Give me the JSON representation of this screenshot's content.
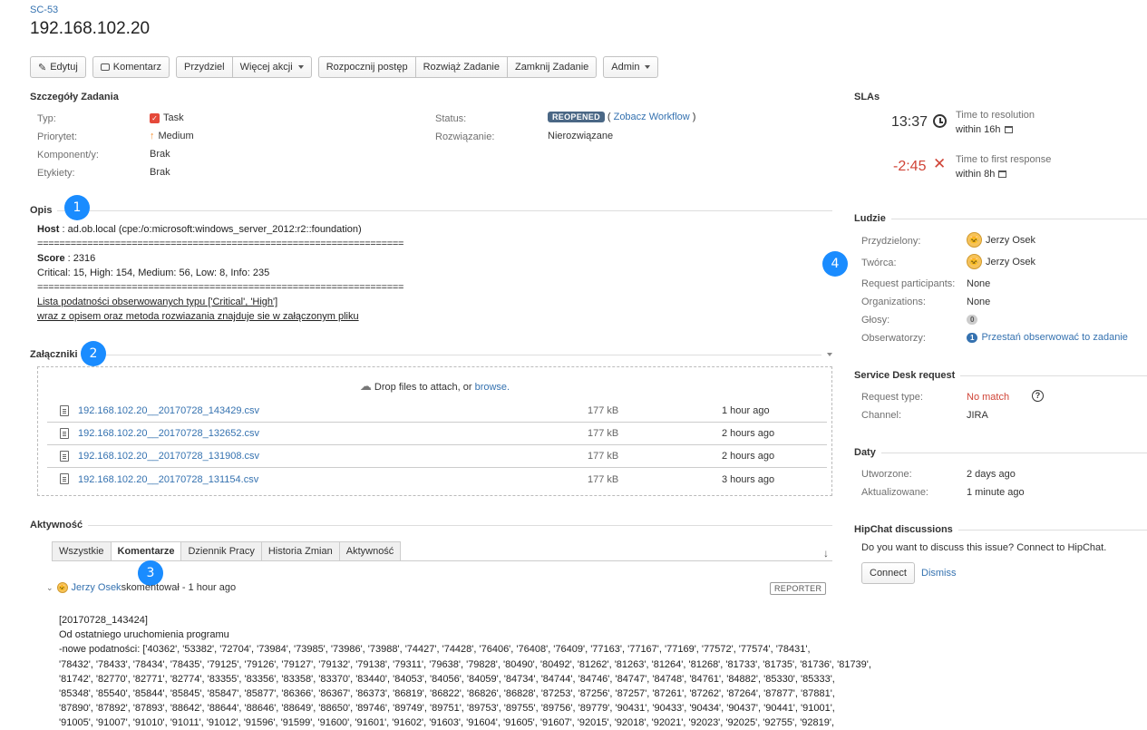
{
  "issue": {
    "key": "SC-53",
    "title": "192.168.102.20"
  },
  "toolbar": {
    "edit": "Edytuj",
    "comment": "Komentarz",
    "assign": "Przydziel",
    "more": "Więcej akcji",
    "start": "Rozpocznij postęp",
    "resolve": "Rozwiąż Zadanie",
    "close": "Zamknij Zadanie",
    "admin": "Admin"
  },
  "details": {
    "heading": "Szczegóły Zadania",
    "type_label": "Typ:",
    "type_value": "Task",
    "priority_label": "Priorytet:",
    "priority_value": "Medium",
    "components_label": "Komponent/y:",
    "components_value": "Brak",
    "labels_label": "Etykiety:",
    "labels_value": "Brak",
    "status_label": "Status:",
    "status_value": "REOPENED",
    "workflow_link": "Zobacz Workflow",
    "resolution_label": "Rozwiązanie:",
    "resolution_value": "Nierozwiązane"
  },
  "description": {
    "heading": "Opis",
    "host_label": "Host",
    "host_value": " : ad.ob.local (cpe:/o:microsoft:windows_server_2012:r2::foundation)",
    "separator": "==================================================================",
    "score_label": "Score",
    "score_value": " : 2316",
    "counts": "Critical: 15, High: 154, Medium: 56, Low: 8, Info: 235",
    "list_link": "Lista podatności",
    "list_rest": " obserwowanych typu ['Critical', 'High']",
    "attach_line": "wraz z opisem oraz metoda rozwiazania znajduje sie w załączonym pliku"
  },
  "attachments": {
    "heading": "Załączniki",
    "drop_text": "Drop files to attach, or ",
    "browse": "browse.",
    "files": [
      {
        "name": "192.168.102.20__20170728_143429.csv",
        "size": "177 kB",
        "date": "1 hour ago"
      },
      {
        "name": "192.168.102.20__20170728_132652.csv",
        "size": "177 kB",
        "date": "2 hours ago"
      },
      {
        "name": "192.168.102.20__20170728_131908.csv",
        "size": "177 kB",
        "date": "2 hours ago"
      },
      {
        "name": "192.168.102.20__20170728_131154.csv",
        "size": "177 kB",
        "date": "3 hours ago"
      }
    ]
  },
  "activity": {
    "heading": "Aktywność",
    "tabs": [
      "Wszystkie",
      "Komentarze",
      "Dziennik Pracy",
      "Historia Zmian",
      "Aktywność"
    ],
    "comment_author": "Jerzy Osek",
    "comment_action": " skomentował - 1 hour ago",
    "reporter_badge": "REPORTER",
    "comment_lines": [
      "[20170728_143424]",
      "Od ostatniego uruchomienia programu",
      "-nowe podatności: ['40362', '53382', '72704', '73984', '73985', '73986', '73988', '74427', '74428', '76406', '76408', '76409', '77163', '77167', '77169', '77572', '77574', '78431',",
      "'78432', '78433', '78434', '78435', '79125', '79126', '79127', '79132', '79138', '79311', '79638', '79828', '80490', '80492', '81262', '81263', '81264', '81268', '81733', '81735', '81736', '81739',",
      "'81742', '82770', '82771', '82774', '83355', '83356', '83358', '83370', '83440', '84053', '84056', '84059', '84734', '84744', '84746', '84747', '84748', '84761', '84882', '85330', '85333',",
      "'85348', '85540', '85844', '85845', '85847', '85877', '86366', '86367', '86373', '86819', '86822', '86826', '86828', '87253', '87256', '87257', '87261', '87262', '87264', '87877', '87881',",
      "'87890', '87892', '87893', '88642', '88644', '88646', '88649', '88650', '89746', '89749', '89751', '89753', '89755', '89756', '89779', '90431', '90433', '90434', '90437', '90441', '91001',",
      "'91005', '91007', '91010', '91011', '91012', '91596', '91599', '91600', '91601', '91602', '91603', '91604', '91605', '91607', '92015', '92018', '92021', '92023', '92025', '92755', '92819',"
    ]
  },
  "slas": {
    "heading": "SLAs",
    "items": [
      {
        "time": "13:37",
        "title": "Time to resolution",
        "within": "within 16h"
      },
      {
        "time": "-2:45",
        "title": "Time to first response",
        "within": "within 8h"
      }
    ]
  },
  "people": {
    "heading": "Ludzie",
    "assignee_label": "Przydzielony:",
    "assignee": "Jerzy Osek",
    "creator_label": "Twórca:",
    "creator": "Jerzy Osek",
    "participants_label": "Request participants:",
    "participants": "None",
    "orgs_label": "Organizations:",
    "orgs": "None",
    "votes_label": "Głosy:",
    "votes": "0",
    "watchers_label": "Obserwatorzy:",
    "watchers": "1",
    "unwatch": "Przestań obserwować to zadanie"
  },
  "sd_request": {
    "heading": "Service Desk request",
    "type_label": "Request type:",
    "type_value": "No match",
    "channel_label": "Channel:",
    "channel_value": "JIRA"
  },
  "dates": {
    "heading": "Daty",
    "created_label": "Utworzone:",
    "created": "2 days ago",
    "updated_label": "Aktualizowane:",
    "updated": "1 minute ago"
  },
  "hipchat": {
    "heading": "HipChat discussions",
    "text": "Do you want to discuss this issue? Connect to HipChat.",
    "connect": "Connect",
    "dismiss": "Dismiss"
  },
  "markers": [
    "1",
    "2",
    "3",
    "4"
  ],
  "colors": {
    "link": "#3572b0",
    "status": "#4a6785",
    "negative": "#d04437",
    "marker": "#1a8cff"
  }
}
